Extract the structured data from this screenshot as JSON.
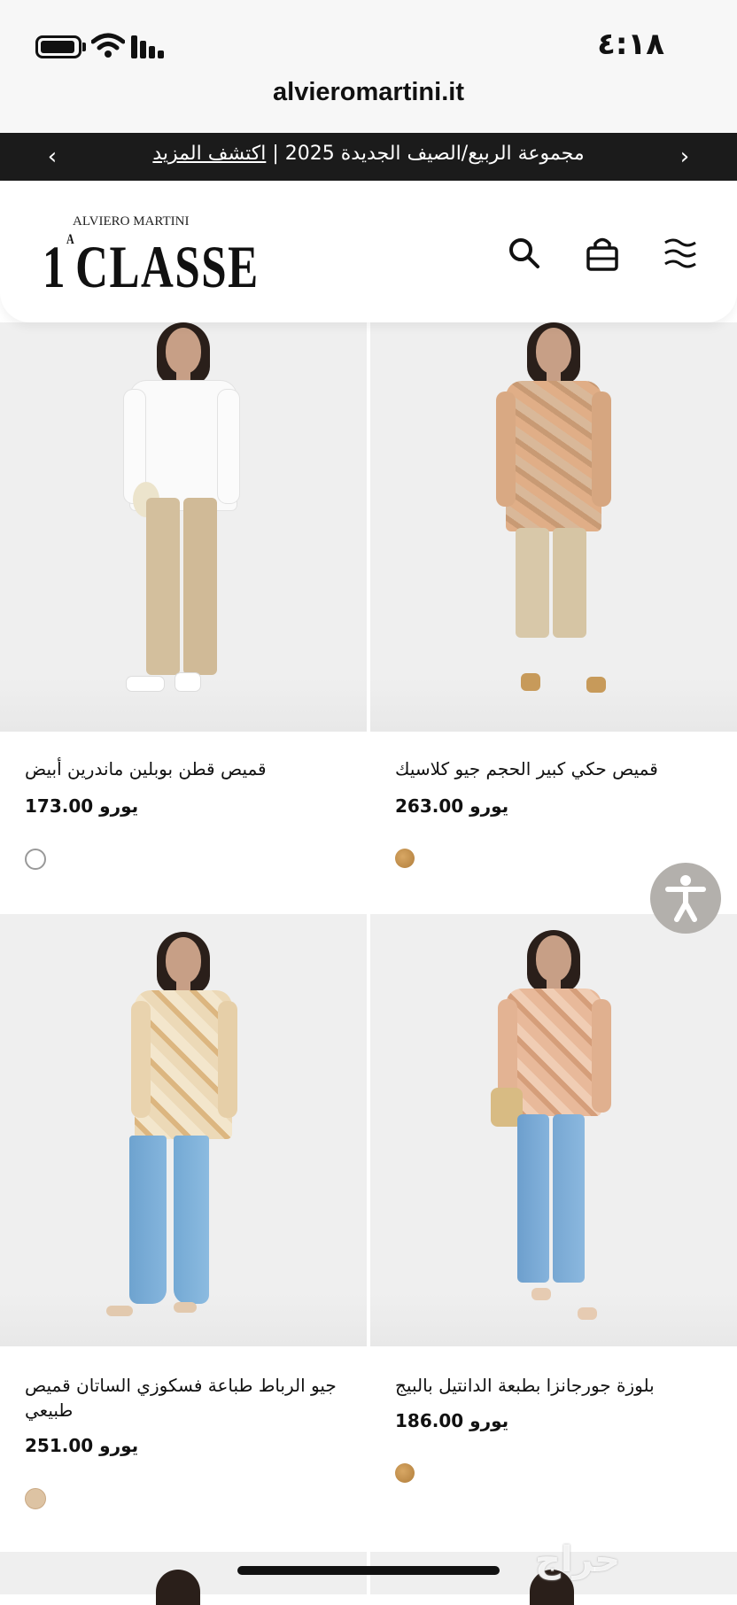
{
  "status_bar": {
    "time": "٤:١٨",
    "url": "alvieromartini.it"
  },
  "announcement": {
    "text": "مجموعة الربيع/الصيف الجديدة 2025 |",
    "link": "اكتشف المزيد",
    "prev": "‹",
    "next": "›"
  },
  "header": {
    "logo_top": "ALVIERO MARTINI",
    "logo_main": "CLASSE",
    "logo_num": "1",
    "logo_sup": "A",
    "icons": [
      "search-icon",
      "bag-icon",
      "menu-icon"
    ]
  },
  "products": [
    {
      "name": "قميص قطن بوبلين ماندرين أبيض",
      "price": "173.00 يورو",
      "swatch_color": "#ffffff"
    },
    {
      "name": "قميص حكي كبير الحجم جيو كلاسيك",
      "price": "263.00 يورو",
      "swatch_color": "#c9954f"
    },
    {
      "name": "جيو الرباط طباعة فسكوزي الساتان قميص طبيعي",
      "price": "251.00 يورو",
      "swatch_color": "#ddc3a3"
    },
    {
      "name": "بلوزة جورجانزا بطبعة الدانتيل بالبيج",
      "price": "186.00 يورو",
      "swatch_color": "#c9954f"
    }
  ],
  "colors": {
    "announce_bg": "#1b1b1b",
    "image_bg": "#efefef",
    "a11y_bg": "#b3b0ac"
  },
  "watermark": "حراج"
}
